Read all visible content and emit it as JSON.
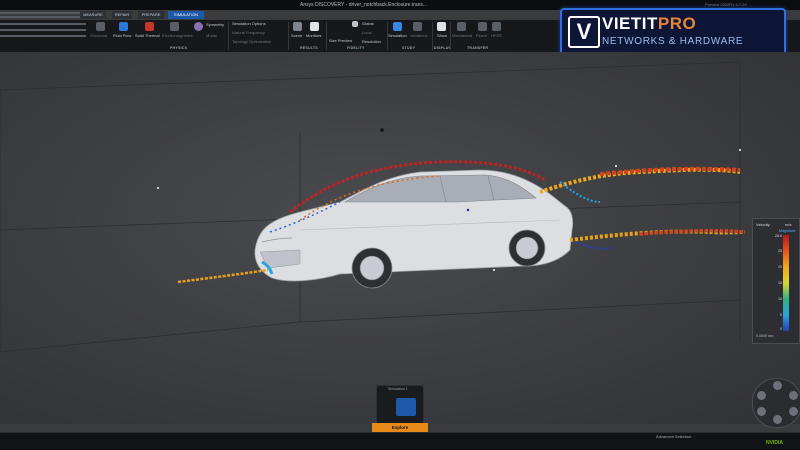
{
  "window": {
    "title": "Ansys DISCOVERY - driver_notchback.Enclosure.trans...",
    "preview_label": "Preview 2022R1 6.7.29"
  },
  "tabs": [
    {
      "label": "Measure"
    },
    {
      "label": "Repair"
    },
    {
      "label": "Prepare"
    },
    {
      "label": "Simulation",
      "active": true
    }
  ],
  "ribbon": {
    "physics": {
      "group_label": "Physics",
      "structural": "Structural",
      "fluid_flow": "Fluid Flow",
      "solid_thermal": "Solid Thermal",
      "electromagnetics": "Electromagnetics",
      "modal": "Modal"
    },
    "options": {
      "symmetry": "Symmetry",
      "sim_options": "Simulation Options",
      "natural_freq": "Natural Frequency",
      "topology_opt": "Topology Optimization"
    },
    "results": {
      "group_label": "Results",
      "scene": "Scene",
      "monitors": "Monitors"
    },
    "fidelity": {
      "group_label": "Fidelity",
      "global": "Global",
      "local": "Local",
      "size_preview": "Size Preview",
      "resolution": "Resolution"
    },
    "study": {
      "group_label": "Study",
      "simulation": "Simulation",
      "variations": "Variations"
    },
    "display": {
      "group_label": "Display",
      "show": "Show"
    },
    "transfer": {
      "group_label": "Transfer",
      "mechanical": "Mechanical",
      "fluent": "Fluent",
      "hfss": "HFSS"
    }
  },
  "brand": {
    "name_main": "VIETIT",
    "name_accent": "PRO",
    "tagline": "NETWORKS & HARDWARE",
    "mark": "V"
  },
  "legend": {
    "header": "Velocity",
    "unit": "m/s",
    "quantity": "Magnitude",
    "ticks": [
      "28.6",
      "25",
      "20",
      "15",
      "10",
      "5",
      "0"
    ],
    "footer": "0.0849 sec",
    "colors": [
      "#b61818",
      "#e8541b",
      "#f0a81c",
      "#d9d531",
      "#2fb07e",
      "#2aa4e0",
      "#2540b8"
    ]
  },
  "bottom": {
    "explore_title": "Simulation 1",
    "explore_button": "Explore",
    "status": "Advanced Selection"
  },
  "vendor": {
    "nvidia": "NVIDIA"
  }
}
